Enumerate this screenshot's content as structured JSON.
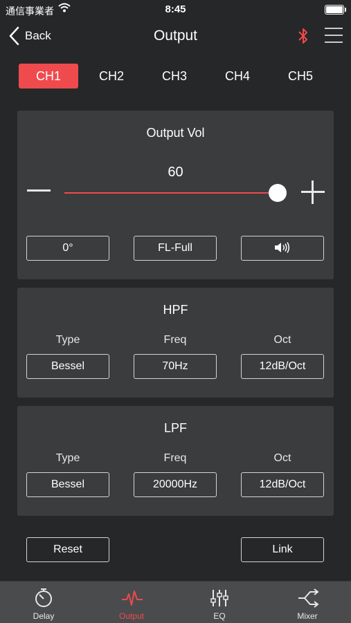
{
  "status": {
    "carrier": "通信事業者",
    "time": "8:45"
  },
  "nav": {
    "back_label": "Back",
    "title": "Output"
  },
  "tabs": [
    {
      "label": "CH1",
      "active": true
    },
    {
      "label": "CH2",
      "active": false
    },
    {
      "label": "CH3",
      "active": false
    },
    {
      "label": "CH4",
      "active": false
    },
    {
      "label": "CH5",
      "active": false
    }
  ],
  "output_vol": {
    "title": "Output Vol",
    "value": "60",
    "level_fraction": 1.0,
    "phase": "0°",
    "channel": "FL-Full"
  },
  "hpf": {
    "title": "HPF",
    "type_label": "Type",
    "type_value": "Bessel",
    "freq_label": "Freq",
    "freq_value": "70Hz",
    "oct_label": "Oct",
    "oct_value": "12dB/Oct"
  },
  "lpf": {
    "title": "LPF",
    "type_label": "Type",
    "type_value": "Bessel",
    "freq_label": "Freq",
    "freq_value": "20000Hz",
    "oct_label": "Oct",
    "oct_value": "12dB/Oct"
  },
  "actions": {
    "reset_label": "Reset",
    "link_label": "Link"
  },
  "bottom_nav": [
    {
      "label": "Delay",
      "icon": "stopwatch-icon",
      "active": false
    },
    {
      "label": "Output",
      "icon": "waveform-icon",
      "active": true
    },
    {
      "label": "EQ",
      "icon": "sliders-icon",
      "active": false
    },
    {
      "label": "Mixer",
      "icon": "mixer-arrows-icon",
      "active": false
    }
  ],
  "colors": {
    "accent": "#ef4a4d",
    "background": "#262729",
    "card": "#3b3c3e",
    "tab_bar": "#4a4b4d"
  }
}
